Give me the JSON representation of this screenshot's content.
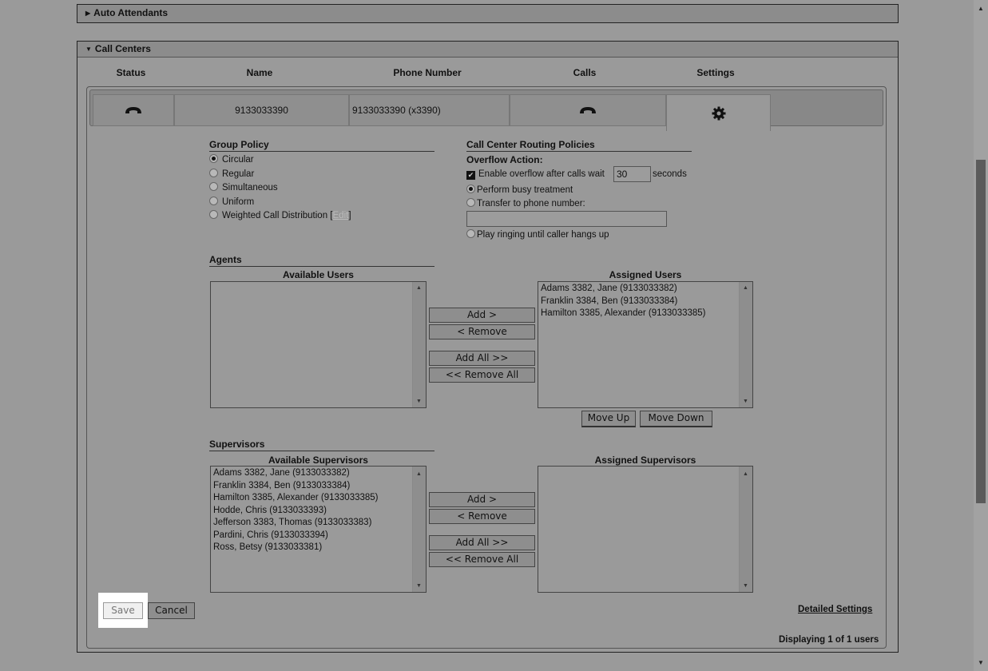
{
  "sections": {
    "auto_attendants": "Auto Attendants",
    "call_centers": "Call Centers"
  },
  "columns": [
    "Status",
    "Name",
    "Phone Number",
    "Calls",
    "Settings"
  ],
  "row": {
    "name": "9133033390",
    "phone": "9133033390 (x3390)"
  },
  "group_policy": {
    "title": "Group Policy",
    "options": [
      "Circular",
      "Regular",
      "Simultaneous",
      "Uniform",
      "Weighted Call Distribution ["
    ],
    "edit_link": "Edit",
    "edit_close": "]",
    "selected": "Circular"
  },
  "routing": {
    "title": "Call Center Routing Policies",
    "overflow_title": "Overflow Action:",
    "enable_label": "Enable overflow after calls wait",
    "wait_value": "30",
    "seconds": "seconds",
    "busy": "Perform busy treatment",
    "transfer": "Transfer to phone number:",
    "transfer_value": "",
    "ringing": "Play ringing until caller hangs up"
  },
  "agents": {
    "title": "Agents",
    "available_label": "Available Users",
    "assigned_label": "Assigned Users",
    "available": [],
    "assigned": [
      "Adams 3382, Jane (9133033382)",
      "Franklin 3384, Ben (9133033384)",
      "Hamilton 3385, Alexander (9133033385)"
    ]
  },
  "supervisors": {
    "title": "Supervisors",
    "available_label": "Available Supervisors",
    "assigned_label": "Assigned Supervisors",
    "available": [
      "Adams 3382, Jane (9133033382)",
      "Franklin 3384, Ben (9133033384)",
      "Hamilton 3385, Alexander (9133033385)",
      "Hodde, Chris (9133033393)",
      "Jefferson 3383, Thomas (9133033383)",
      "Pardini, Chris (9133033394)",
      "Ross, Betsy (9133033381)"
    ],
    "assigned": []
  },
  "buttons": {
    "add": "Add >",
    "remove": "< Remove",
    "add_all": "Add All >>",
    "remove_all": "<< Remove All",
    "move_up": "Move Up",
    "move_down": "Move Down",
    "save": "Save",
    "cancel": "Cancel"
  },
  "links": {
    "detailed_settings": "Detailed Settings"
  },
  "footer": {
    "displaying": "Displaying 1 of 1 users"
  },
  "icons": {
    "status": "phone-icon",
    "calls": "phone-icon",
    "settings": "gear-icon"
  }
}
